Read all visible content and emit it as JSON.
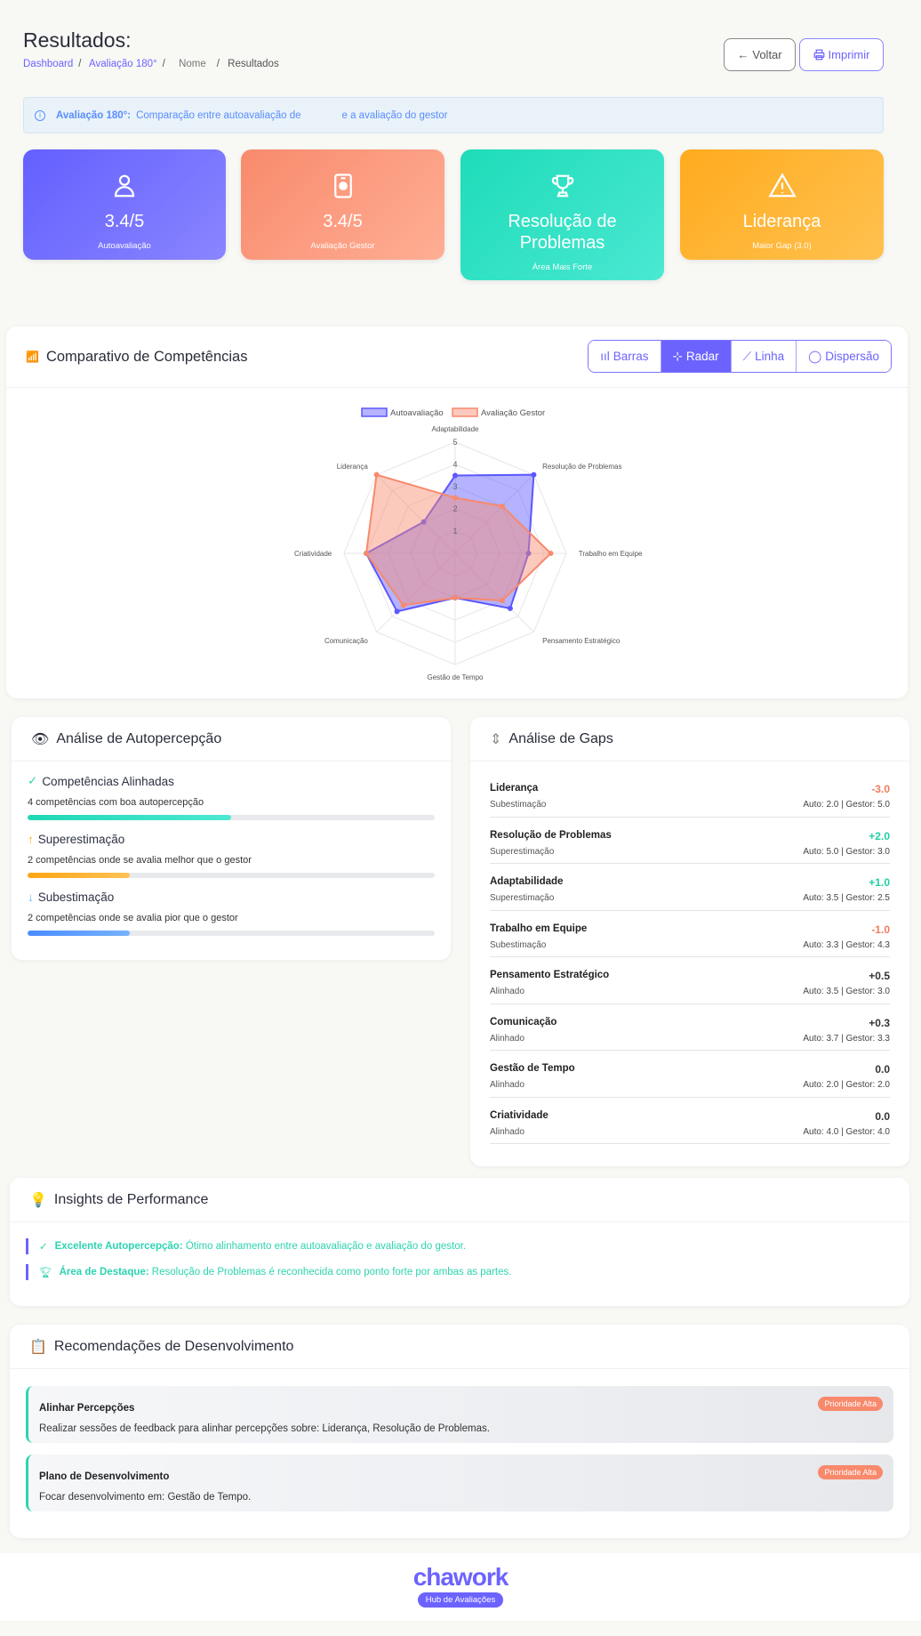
{
  "header": {
    "title": "Resultados:",
    "breadcrumb": [
      "Dashboard",
      "Avaliação 180°",
      "Nome",
      "Resultados"
    ],
    "back_label": "Voltar",
    "print_label": "Imprimir"
  },
  "info": {
    "bold": "Avaliação 180°:",
    "text": "Comparação entre autoavaliação de",
    "text2": "e a avaliação do gestor"
  },
  "stats": [
    {
      "value": "3.4/5",
      "label": "Autoavaliação",
      "icon": "user-icon"
    },
    {
      "value": "3.4/5",
      "label": "Avaliação Gestor",
      "icon": "badge-icon"
    },
    {
      "value": "Resolução de Problemas",
      "label": "Área Mais Forte",
      "icon": "trophy-icon"
    },
    {
      "value": "Liderança",
      "label": "Maior Gap (3.0)",
      "icon": "warning-icon"
    }
  ],
  "colors": {
    "primary": "#6c63ff",
    "auto": "#5b57ff",
    "gestor": "#f8896c",
    "teal": "#2ed3b0",
    "orange": "#ffad20",
    "blue": "#5a9cff"
  },
  "chart_card": {
    "title": "Comparativo de Competências",
    "tabs": [
      "Barras",
      "Radar",
      "Linha",
      "Dispersão"
    ],
    "active_tab": "Radar"
  },
  "chart_data": {
    "type": "radar",
    "categories": [
      "Adaptabilidade",
      "Resolução de Problemas",
      "Trabalho em Equipe",
      "Pensamento Estratégico",
      "Gestão de Tempo",
      "Comunicação",
      "Criatividade",
      "Liderança"
    ],
    "series": [
      {
        "name": "Autoavaliação",
        "values": [
          3.5,
          5.0,
          3.3,
          3.5,
          2.0,
          3.7,
          4.0,
          2.0
        ],
        "color": "#5b57ff"
      },
      {
        "name": "Avaliação Gestor",
        "values": [
          2.5,
          3.0,
          4.3,
          3.0,
          2.0,
          3.3,
          4.0,
          5.0
        ],
        "color": "#f8896c"
      }
    ],
    "rlim": [
      0,
      5
    ],
    "ticks": [
      "1",
      "2",
      "3",
      "4",
      "5"
    ],
    "legend": "top"
  },
  "autopercepcao": {
    "title": "Análise de Autopercepção",
    "items": [
      {
        "title": "Competências Alinhadas",
        "desc": "4 competências com boa autopercepção",
        "progress": 0.5
      },
      {
        "title": "Superestimação",
        "desc": "2 competências onde se avalia melhor que o gestor",
        "progress": 0.25
      },
      {
        "title": "Subestimação",
        "desc": "2 competências onde se avalia pior que o gestor",
        "progress": 0.25
      }
    ]
  },
  "gaps": {
    "title": "Análise de Gaps",
    "items": [
      {
        "name": "Liderança",
        "status": "Subestimação",
        "gap": "-3.0",
        "auto": "Auto: 2.0 | Gestor: 5.0",
        "tone": "neg"
      },
      {
        "name": "Resolução de Problemas",
        "status": "Superestimação",
        "gap": "+2.0",
        "auto": "Auto: 5.0 | Gestor: 3.0",
        "tone": "pos"
      },
      {
        "name": "Adaptabilidade",
        "status": "Superestimação",
        "gap": "+1.0",
        "auto": "Auto: 3.5 | Gestor: 2.5",
        "tone": "pos"
      },
      {
        "name": "Trabalho em Equipe",
        "status": "Subestimação",
        "gap": "-1.0",
        "auto": "Auto: 3.3 | Gestor: 4.3",
        "tone": "neg"
      },
      {
        "name": "Pensamento Estratégico",
        "status": "Alinhado",
        "gap": "+0.5",
        "auto": "Auto: 3.5 | Gestor: 3.0",
        "tone": "neu"
      },
      {
        "name": "Comunicação",
        "status": "Alinhado",
        "gap": "+0.3",
        "auto": "Auto: 3.7 | Gestor: 3.3",
        "tone": "neu"
      },
      {
        "name": "Gestão de Tempo",
        "status": "Alinhado",
        "gap": "0.0",
        "auto": "Auto: 2.0 | Gestor: 2.0",
        "tone": "neu"
      },
      {
        "name": "Criatividade",
        "status": "Alinhado",
        "gap": "0.0",
        "auto": "Auto: 4.0 | Gestor: 4.0",
        "tone": "neu"
      }
    ]
  },
  "insights": {
    "title": "Insights de Performance",
    "items": [
      {
        "bold": "Excelente Autopercepção:",
        "text": "Ótimo alinhamento entre autoavaliação e avaliação do gestor."
      },
      {
        "bold": "Área de Destaque:",
        "text": "Resolução de Problemas é reconhecida como ponto forte por ambas as partes."
      }
    ]
  },
  "recs": {
    "title": "Recomendações de Desenvolvimento",
    "items": [
      {
        "title": "Alinhar Percepções",
        "desc": "Realizar sessões de feedback para alinhar percepções sobre: Liderança, Resolução de Problemas.",
        "badge": "Prioridade Alta"
      },
      {
        "title": "Plano de Desenvolvimento",
        "desc": "Focar desenvolvimento em: Gestão de Tempo.",
        "badge": "Prioridade Alta"
      }
    ]
  },
  "footer": {
    "logo": "chawork",
    "tagline": "Hub de Avaliações"
  }
}
